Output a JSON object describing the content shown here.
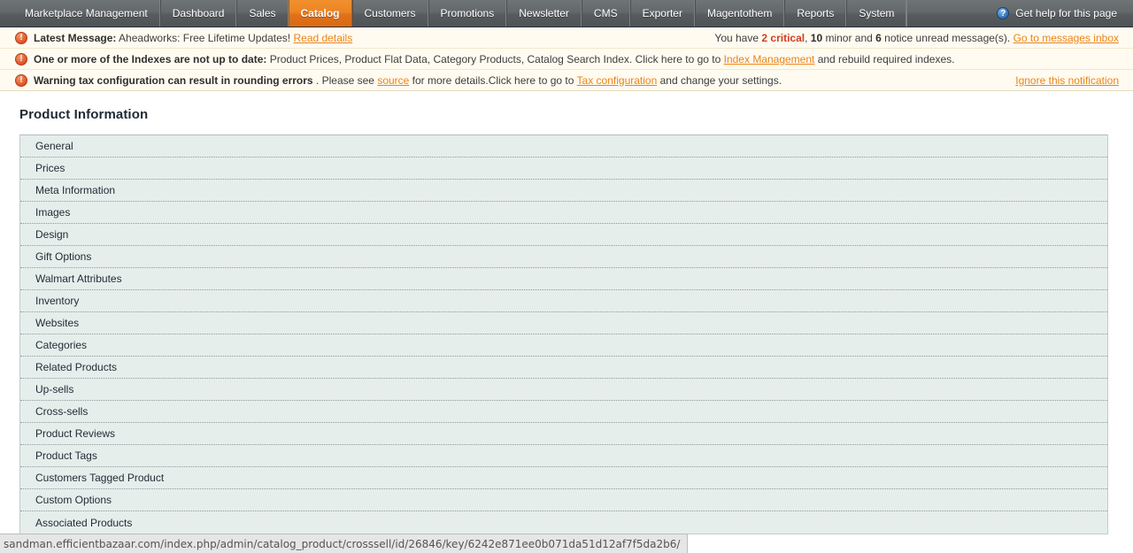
{
  "nav": {
    "items": [
      {
        "label": "Marketplace Management",
        "active": false
      },
      {
        "label": "Dashboard",
        "active": false
      },
      {
        "label": "Sales",
        "active": false
      },
      {
        "label": "Catalog",
        "active": true
      },
      {
        "label": "Customers",
        "active": false
      },
      {
        "label": "Promotions",
        "active": false
      },
      {
        "label": "Newsletter",
        "active": false
      },
      {
        "label": "CMS",
        "active": false
      },
      {
        "label": "Exporter",
        "active": false
      },
      {
        "label": "Magentothem",
        "active": false
      },
      {
        "label": "Reports",
        "active": false
      },
      {
        "label": "System",
        "active": false
      }
    ],
    "help_label": "Get help for this page",
    "help_icon": "question-circle-icon",
    "active_color": "#e8801f",
    "bar_color": "#63686b"
  },
  "messages": [
    {
      "icon": "warning-circle-icon",
      "label": "Latest Message:",
      "text": " Aheadworks: Free Lifetime Updates! ",
      "link": "Read details",
      "right": {
        "prefix": "You have ",
        "critical_count": "2",
        "critical_word": " critical",
        "mid1": ", ",
        "minor_count": "10",
        "minor_word": " minor and ",
        "notice_count": "6",
        "notice_word": " notice unread message(s). ",
        "link": "Go to messages inbox"
      }
    },
    {
      "icon": "warning-circle-icon",
      "label": "One or more of the Indexes are not up to date:",
      "text": " Product Prices, Product Flat Data, Category Products, Catalog Search Index. Click here to go to ",
      "link": "Index Management",
      "text_after": " and rebuild required indexes."
    },
    {
      "icon": "warning-circle-icon",
      "label": "Warning tax configuration can result in rounding errors",
      "text": " . Please see ",
      "link": "source",
      "text_mid": " for more details.Click here to go to ",
      "link2": "Tax configuration",
      "text_after": " and change your settings.",
      "right_link": "Ignore this notification"
    }
  ],
  "main": {
    "page_title": "Product Information",
    "tabs": [
      {
        "label": "General"
      },
      {
        "label": "Prices"
      },
      {
        "label": "Meta Information"
      },
      {
        "label": "Images"
      },
      {
        "label": "Design"
      },
      {
        "label": "Gift Options"
      },
      {
        "label": "Walmart Attributes"
      },
      {
        "label": "Inventory"
      },
      {
        "label": "Websites"
      },
      {
        "label": "Categories"
      },
      {
        "label": "Related Products"
      },
      {
        "label": "Up-sells"
      },
      {
        "label": "Cross-sells"
      },
      {
        "label": "Product Reviews"
      },
      {
        "label": "Product Tags"
      },
      {
        "label": "Customers Tagged Product"
      },
      {
        "label": "Custom Options"
      },
      {
        "label": "Associated Products"
      }
    ]
  },
  "statusbar": {
    "url": "sandman.efficientbazaar.com/index.php/admin/catalog_product/crosssell/id/26846/key/6242e871ee0b071da51d12af7f5da2b6/"
  }
}
